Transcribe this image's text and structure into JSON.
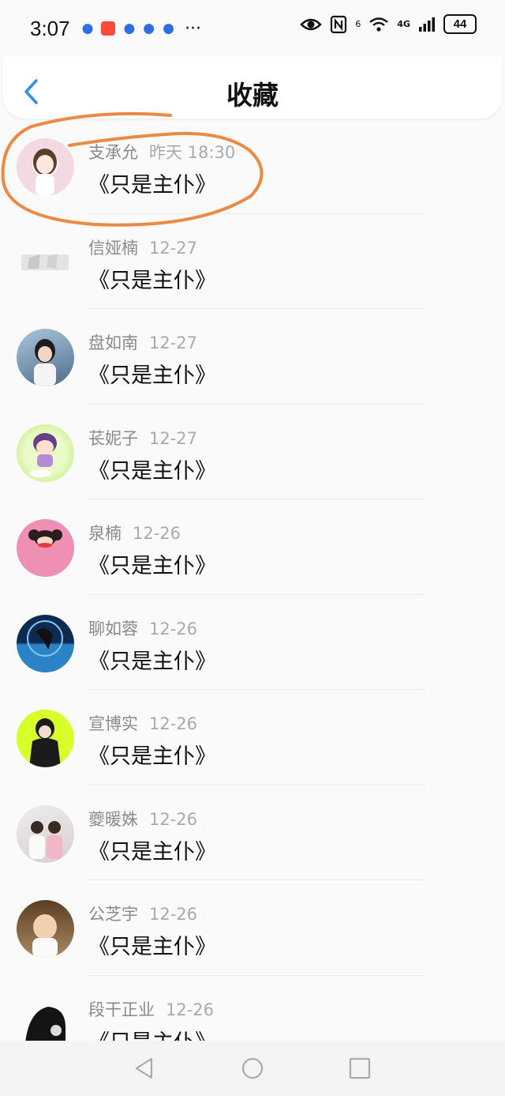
{
  "status_bar": {
    "time": "3:07",
    "signal_label": "4G",
    "sim_label": "6",
    "battery": "44"
  },
  "header": {
    "title": "收藏",
    "back_icon": "chevron-left-icon"
  },
  "items": [
    {
      "name": "支承允",
      "date": "昨天 18:30",
      "text": "《只是主仆》",
      "avatar_color": "#f3d9e2"
    },
    {
      "name": "信娅楠",
      "date": "12-27",
      "text": "《只是主仆》",
      "avatar_color": "#e9e9e9"
    },
    {
      "name": "盘如南",
      "date": "12-27",
      "text": "《只是主仆》",
      "avatar_color": "#6f8ca8"
    },
    {
      "name": "苌妮子",
      "date": "12-27",
      "text": "《只是主仆》",
      "avatar_color": "#cdf08a"
    },
    {
      "name": "泉楠",
      "date": "12-26",
      "text": "《只是主仆》",
      "avatar_color": "#ef8fb3"
    },
    {
      "name": "聊如蓉",
      "date": "12-26",
      "text": "《只是主仆》",
      "avatar_color": "#1f4f8c"
    },
    {
      "name": "宣博实",
      "date": "12-26",
      "text": "《只是主仆》",
      "avatar_color": "#d8ff2a"
    },
    {
      "name": "夔暖姝",
      "date": "12-26",
      "text": "《只是主仆》",
      "avatar_color": "#d9cfcf"
    },
    {
      "name": "公芝宇",
      "date": "12-26",
      "text": "《只是主仆》",
      "avatar_color": "#8a6a46"
    },
    {
      "name": "段干正业",
      "date": "12-26",
      "text": "《只是主仆》",
      "avatar_color": "#1a1a1a"
    }
  ],
  "colors": {
    "accent": "#2d8fe6",
    "annotation": "#ea8a45"
  }
}
